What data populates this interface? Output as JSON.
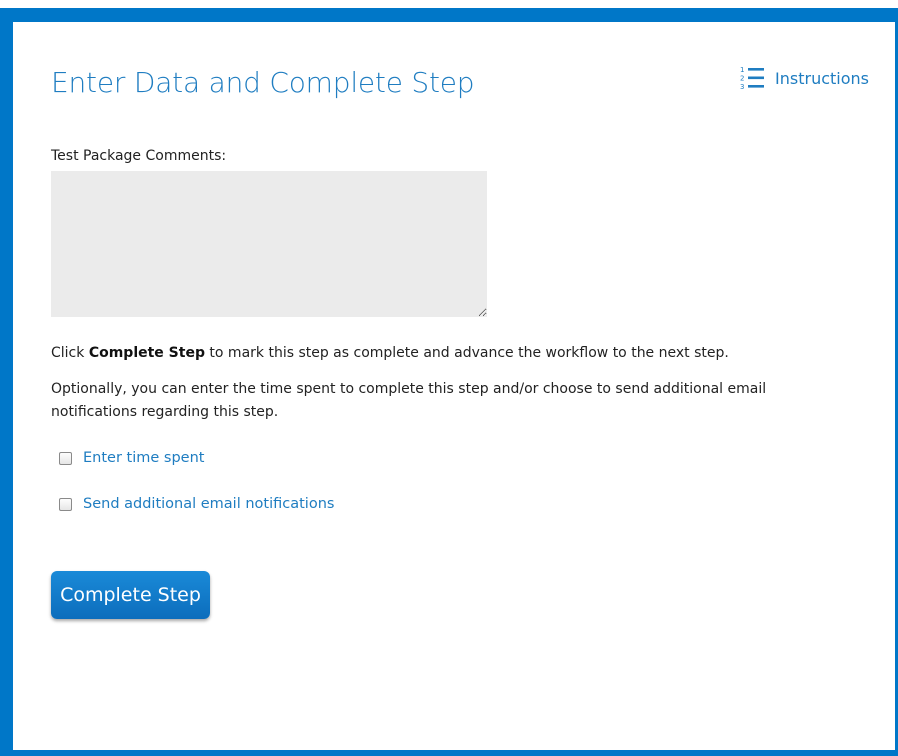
{
  "page": {
    "title": "Enter Data and Complete Step",
    "instructions_link": "Instructions"
  },
  "form": {
    "comments_label": "Test Package Comments:",
    "comments_value": "",
    "intro_click": "Click",
    "intro_bold": "Complete Step",
    "intro_rest": "to mark this step as complete and advance the workflow to the next step.",
    "optional_text": "Optionally, you can enter the time spent to complete this step and/or choose to send additional email notifications regarding this step.",
    "options": [
      {
        "label": "Enter time spent",
        "checked": false
      },
      {
        "label": "Send additional email notifications",
        "checked": false
      }
    ],
    "complete_button": "Complete Step"
  },
  "colors": {
    "frame": "#0077c8",
    "link": "#1f7dc1",
    "button": "#1a8ad8",
    "textarea_bg": "#ebebeb"
  }
}
